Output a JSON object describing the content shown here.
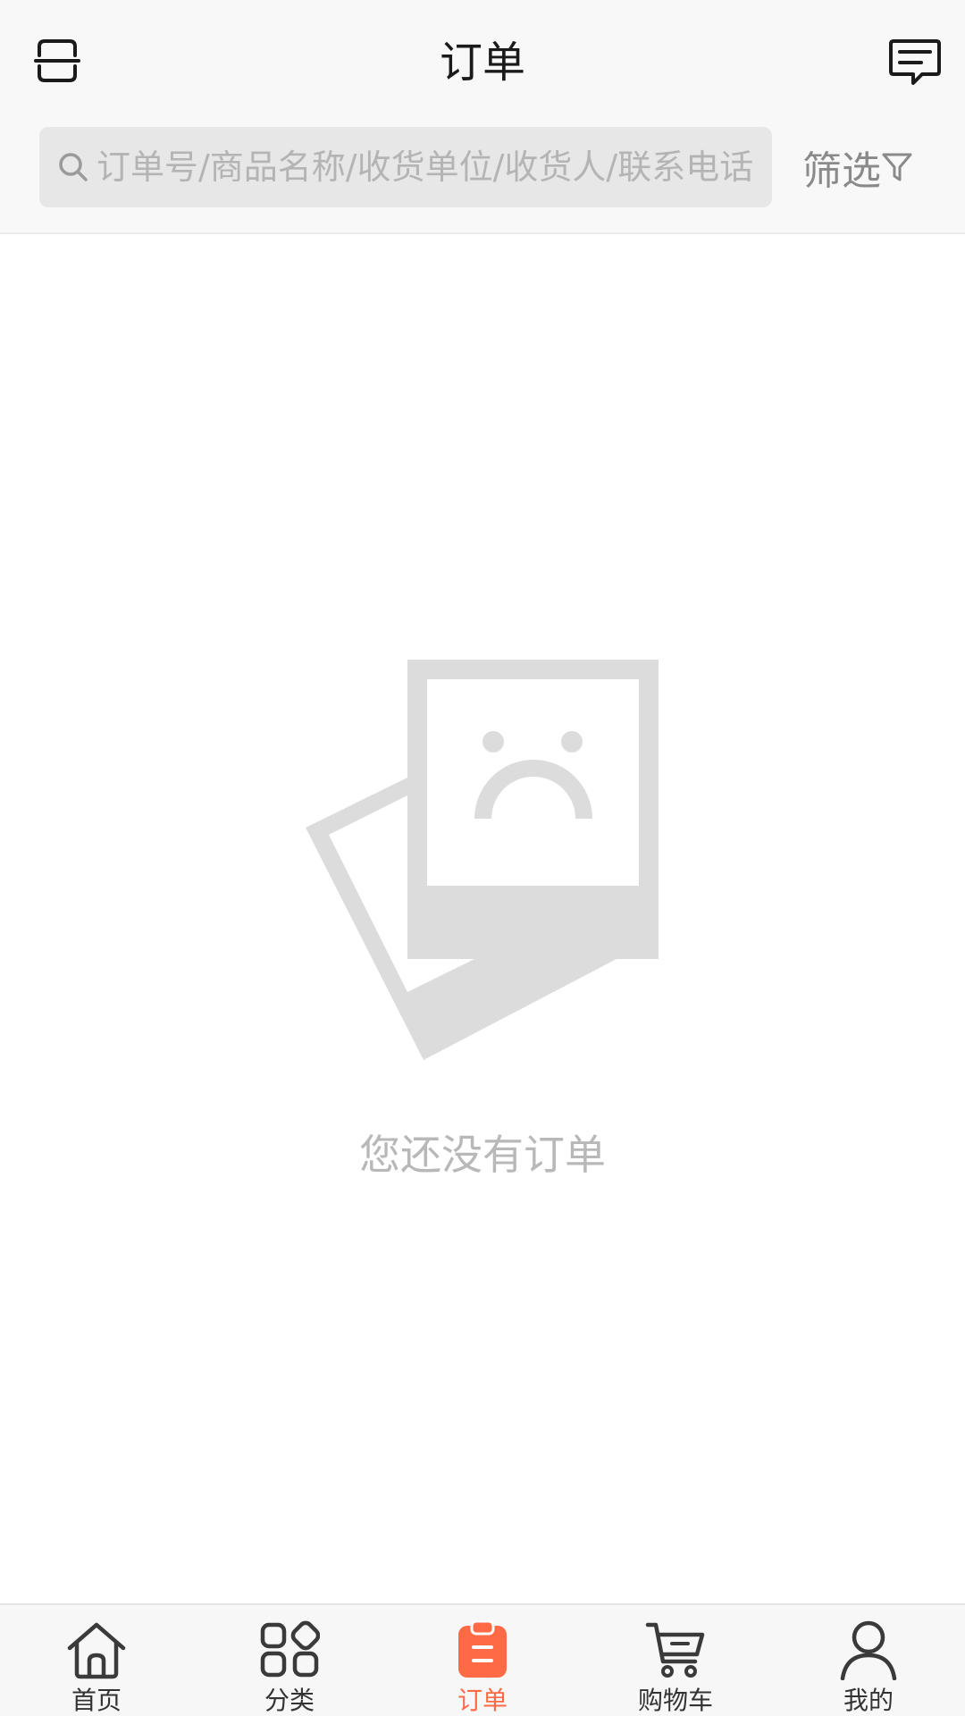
{
  "header": {
    "title": "订单",
    "scan_icon": "scan-icon",
    "message_icon": "message-icon"
  },
  "search": {
    "placeholder": "订单号/商品名称/收货单位/收货人/联系电话",
    "value": "",
    "icon": "search-icon"
  },
  "filter": {
    "label": "筛选",
    "icon": "filter-icon"
  },
  "empty_state": {
    "text": "您还没有订单",
    "icon": "sad-photo-icon"
  },
  "bottom_nav": {
    "items": [
      {
        "label": "首页",
        "icon": "home-icon",
        "active": false
      },
      {
        "label": "分类",
        "icon": "category-icon",
        "active": false
      },
      {
        "label": "订单",
        "icon": "order-icon",
        "active": true
      },
      {
        "label": "购物车",
        "icon": "cart-icon",
        "active": false
      },
      {
        "label": "我的",
        "icon": "profile-icon",
        "active": false
      }
    ]
  },
  "colors": {
    "accent": "#ff6a46",
    "header_bg": "#f8f8f8",
    "search_bg": "#e7e7e7",
    "placeholder_gray": "#b4b4b4",
    "illustration_gray": "#dcdcdc"
  }
}
